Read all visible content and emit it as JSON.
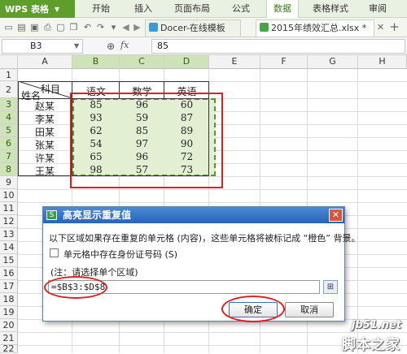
{
  "ribbon": {
    "app_button": "WPS 表格",
    "tabs": [
      "开始",
      "插入",
      "页面布局",
      "公式",
      "数据",
      "表格样式",
      "审阅"
    ],
    "active_tab": "数据"
  },
  "doc_tabs": [
    "Docer-在线模板",
    "2015年绩效汇总.xlsx *"
  ],
  "formula_bar": {
    "name_box": "B3",
    "fx_symbol": "fx",
    "value": "85"
  },
  "columns": [
    "A",
    "B",
    "C",
    "D",
    "E",
    "F",
    "G",
    "H"
  ],
  "rows": [
    "1",
    "2",
    "3",
    "4",
    "5",
    "6",
    "7",
    "8",
    "9",
    "10",
    "11",
    "12",
    "13",
    "14",
    "15",
    "16",
    "17",
    "18",
    "19",
    "20",
    "21",
    "22"
  ],
  "table": {
    "corner_top": "科目",
    "corner_bottom": "姓名",
    "headers": [
      "语文",
      "数学",
      "英语"
    ],
    "rows": [
      {
        "name": "赵某",
        "values": [
          "85",
          "96",
          "60"
        ]
      },
      {
        "name": "李某",
        "values": [
          "93",
          "59",
          "87"
        ]
      },
      {
        "name": "田某",
        "values": [
          "62",
          "85",
          "89"
        ]
      },
      {
        "name": "张某",
        "values": [
          "54",
          "97",
          "90"
        ]
      },
      {
        "name": "许某",
        "values": [
          "65",
          "96",
          "72"
        ]
      },
      {
        "name": "王某",
        "values": [
          "98",
          "57",
          "73"
        ]
      }
    ]
  },
  "dialog": {
    "title": "高亮显示重复值",
    "description": "以下区域如果存在重复的单元格 (内容)，这些单元格将被标记成 “橙色” 背景。",
    "checkbox_label": "单元格中存在身份证号码 (S)",
    "note": "(注：请选择单个区域)",
    "range_value": "=$B$3:$D$8",
    "ok_label": "确定",
    "cancel_label": "取消",
    "close_glyph": "✕",
    "logo_glyph": "S"
  },
  "watermark": {
    "line1": "jb51.net",
    "line2": "脚本之家"
  },
  "colors": {
    "accent_green": "#5e9e2b",
    "selection_fill": "#e2efd3",
    "selection_border": "#4f9a2a",
    "annotation_red": "#e02020",
    "dialog_title": "#2763b8"
  }
}
